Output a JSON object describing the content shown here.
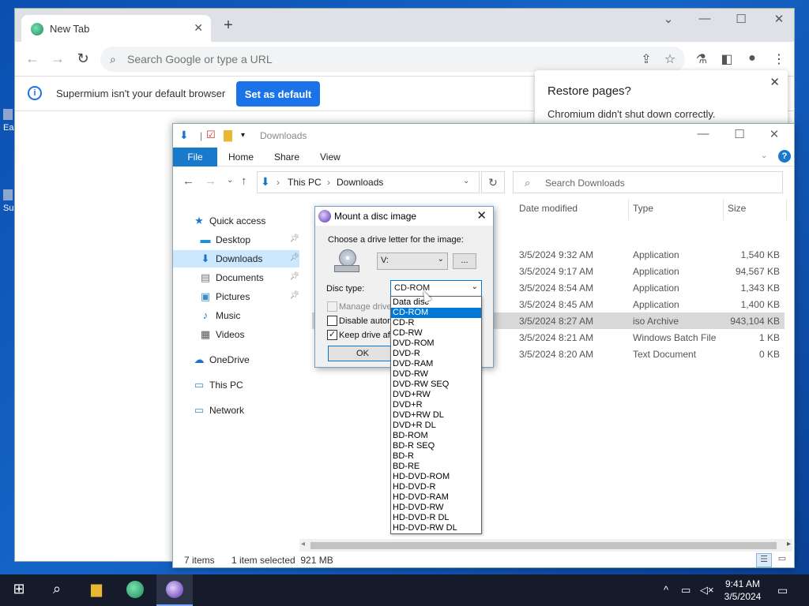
{
  "desktop": {
    "icon1_label": "Ea",
    "icon2_label": "Su"
  },
  "browser": {
    "tab_title": "New Tab",
    "omnibox_placeholder": "Search Google or type a URL",
    "infobar_message": "Supermium isn't your default browser",
    "set_default_label": "Set as default",
    "restore_title": "Restore pages?",
    "restore_message": "Chromium didn't shut down correctly."
  },
  "explorer": {
    "title": "Downloads",
    "ribbon_tabs": [
      "File",
      "Home",
      "Share",
      "View"
    ],
    "breadcrumb": [
      "This PC",
      "Downloads"
    ],
    "search_placeholder": "Search Downloads",
    "nav": [
      {
        "label": "Quick access",
        "icon": "star-icon"
      },
      {
        "label": "Desktop",
        "icon": "desktop-icon"
      },
      {
        "label": "Downloads",
        "icon": "download-arrow-icon"
      },
      {
        "label": "Documents",
        "icon": "document-icon"
      },
      {
        "label": "Pictures",
        "icon": "pictures-icon"
      },
      {
        "label": "Music",
        "icon": "music-icon"
      },
      {
        "label": "Videos",
        "icon": "video-icon"
      },
      {
        "label": "OneDrive",
        "icon": "cloud-icon"
      },
      {
        "label": "This PC",
        "icon": "computer-icon"
      },
      {
        "label": "Network",
        "icon": "network-icon"
      }
    ],
    "columns": [
      "Date modified",
      "Type",
      "Size"
    ],
    "rows": [
      {
        "date": "3/5/2024 9:32 AM",
        "type": "Application",
        "size": "1,540 KB"
      },
      {
        "date": "3/5/2024 9:17 AM",
        "type": "Application",
        "size": "94,567 KB"
      },
      {
        "date": "3/5/2024 8:54 AM",
        "type": "Application",
        "size": "1,343 KB"
      },
      {
        "date": "3/5/2024 8:45 AM",
        "type": "Application",
        "size": "1,400 KB"
      },
      {
        "date": "3/5/2024 8:27 AM",
        "type": "iso Archive",
        "size": "943,104 KB"
      },
      {
        "date": "3/5/2024 8:21 AM",
        "type": "Windows Batch File",
        "size": "1 KB"
      },
      {
        "date": "3/5/2024 8:20 AM",
        "type": "Text Document",
        "size": "0 KB"
      }
    ],
    "status_items": "7 items",
    "status_selected": "1 item selected  921 MB"
  },
  "dialog": {
    "title": "Mount a disc image",
    "choose_label": "Choose a drive letter for the image:",
    "drive_value": "V:",
    "browse_label": "...",
    "disc_type_label": "Disc type:",
    "disc_type_value": "CD-ROM",
    "manage_label": "Manage drive",
    "disable_label": "Disable autor",
    "keep_label": "Keep drive af",
    "ok_label": "OK",
    "options": [
      "Data disc",
      "CD-ROM",
      "CD-R",
      "CD-RW",
      "DVD-ROM",
      "DVD-R",
      "DVD-RAM",
      "DVD-RW",
      "DVD-RW SEQ",
      "DVD+RW",
      "DVD+R",
      "DVD+RW DL",
      "DVD+R DL",
      "BD-ROM",
      "BD-R SEQ",
      "BD-R",
      "BD-RE",
      "HD-DVD-ROM",
      "HD-DVD-R",
      "HD-DVD-RAM",
      "HD-DVD-RW",
      "HD-DVD-R DL",
      "HD-DVD-RW DL"
    ]
  },
  "taskbar": {
    "time": "9:41 AM",
    "date": "3/5/2024"
  }
}
